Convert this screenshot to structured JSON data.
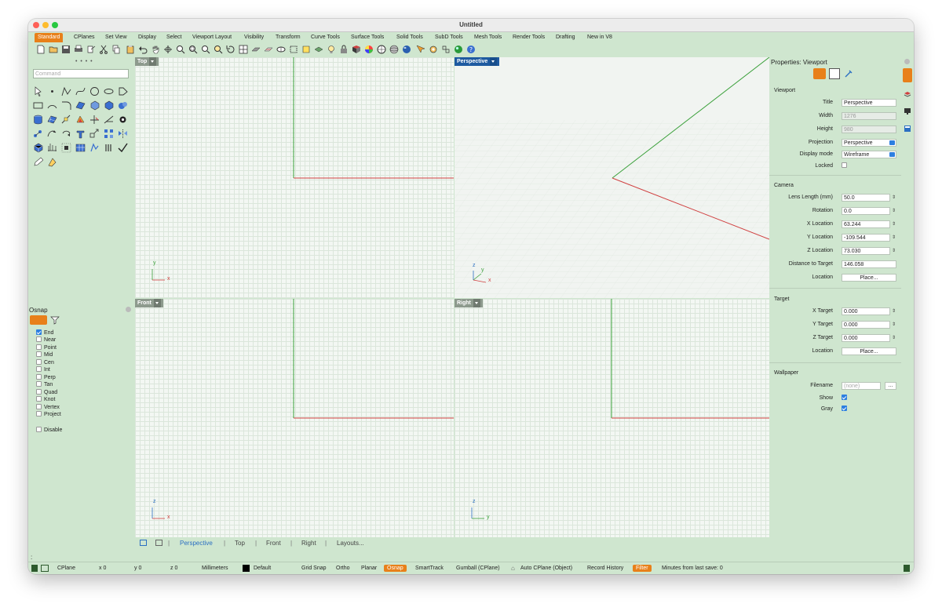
{
  "window": {
    "title": "Untitled"
  },
  "tabs": [
    "Standard",
    "CPlanes",
    "Set View",
    "Display",
    "Select",
    "Viewport Layout",
    "Visibility",
    "Transform",
    "Curve Tools",
    "Surface Tools",
    "Solid Tools",
    "SubD Tools",
    "Mesh Tools",
    "Render Tools",
    "Drafting",
    "New in V8"
  ],
  "active_tab": "Standard",
  "command": {
    "placeholder": "Command"
  },
  "osnap": {
    "title": "Osnap",
    "items": [
      {
        "label": "End",
        "checked": true
      },
      {
        "label": "Near",
        "checked": false
      },
      {
        "label": "Point",
        "checked": false
      },
      {
        "label": "Mid",
        "checked": false
      },
      {
        "label": "Cen",
        "checked": false
      },
      {
        "label": "Int",
        "checked": false
      },
      {
        "label": "Perp",
        "checked": false
      },
      {
        "label": "Tan",
        "checked": false
      },
      {
        "label": "Quad",
        "checked": false
      },
      {
        "label": "Knot",
        "checked": false
      },
      {
        "label": "Vertex",
        "checked": false
      },
      {
        "label": "Project",
        "checked": false
      }
    ],
    "disable": {
      "label": "Disable",
      "checked": false
    }
  },
  "viewports": {
    "top": {
      "title": "Top",
      "axis_a": "y",
      "axis_b": "x"
    },
    "perspective": {
      "title": "Perspective",
      "axis_a": "z",
      "axis_b": "y",
      "axis_c": "x"
    },
    "front": {
      "title": "Front",
      "axis_a": "z",
      "axis_b": "x"
    },
    "right": {
      "title": "Right",
      "axis_a": "z",
      "axis_b": "y"
    }
  },
  "viewport_tabs": [
    "Perspective",
    "Top",
    "Front",
    "Right",
    "Layouts..."
  ],
  "active_viewport_tab": "Perspective",
  "properties": {
    "title": "Properties: Viewport",
    "viewport_section": "Viewport",
    "title_label": "Title",
    "title_value": "Perspective",
    "width_label": "Width",
    "width_value": "1276",
    "height_label": "Height",
    "height_value": "980",
    "projection_label": "Projection",
    "projection_value": "Perspective",
    "display_mode_label": "Display mode",
    "display_mode_value": "Wireframe",
    "locked_label": "Locked",
    "camera_section": "Camera",
    "lens_label": "Lens Length (mm)",
    "lens_value": "50.0",
    "rotation_label": "Rotation",
    "rotation_value": "0.0",
    "xloc_label": "X Location",
    "xloc_value": "63.244",
    "yloc_label": "Y Location",
    "yloc_value": "-109.544",
    "zloc_label": "Z Location",
    "zloc_value": "73.030",
    "dist_label": "Distance to Target",
    "dist_value": "146.058",
    "location_label": "Location",
    "place_label": "Place...",
    "target_section": "Target",
    "xt_label": "X Target",
    "xt_value": "0.000",
    "yt_label": "Y Target",
    "yt_value": "0.000",
    "zt_label": "Z Target",
    "zt_value": "0.000",
    "tlocation_label": "Location",
    "tplace_label": "Place...",
    "wallpaper_section": "Wallpaper",
    "filename_label": "Filename",
    "filename_value": "(none)",
    "browse_label": "...",
    "show_label": "Show",
    "gray_label": "Gray"
  },
  "status": {
    "cplane": "CPlane",
    "x": "x 0",
    "y": "y 0",
    "z": "z 0",
    "units": "Millimeters",
    "layer": "Default",
    "grid_snap": "Grid Snap",
    "ortho": "Ortho",
    "planar": "Planar",
    "osnap": "Osnap",
    "smarttrack": "SmartTrack",
    "gumball": "Gumball (CPlane)",
    "auto_cplane": "Auto CPlane (Object)",
    "record_history": "Record History",
    "filter": "Filter",
    "minutes": "Minutes from last save: 0"
  },
  "colors": {
    "accent": "#e8801a",
    "viewport_active": "#1e5aa0",
    "x_axis": "#d04040",
    "y_axis": "#3aa03a",
    "z_axis": "#2b6fc2"
  }
}
